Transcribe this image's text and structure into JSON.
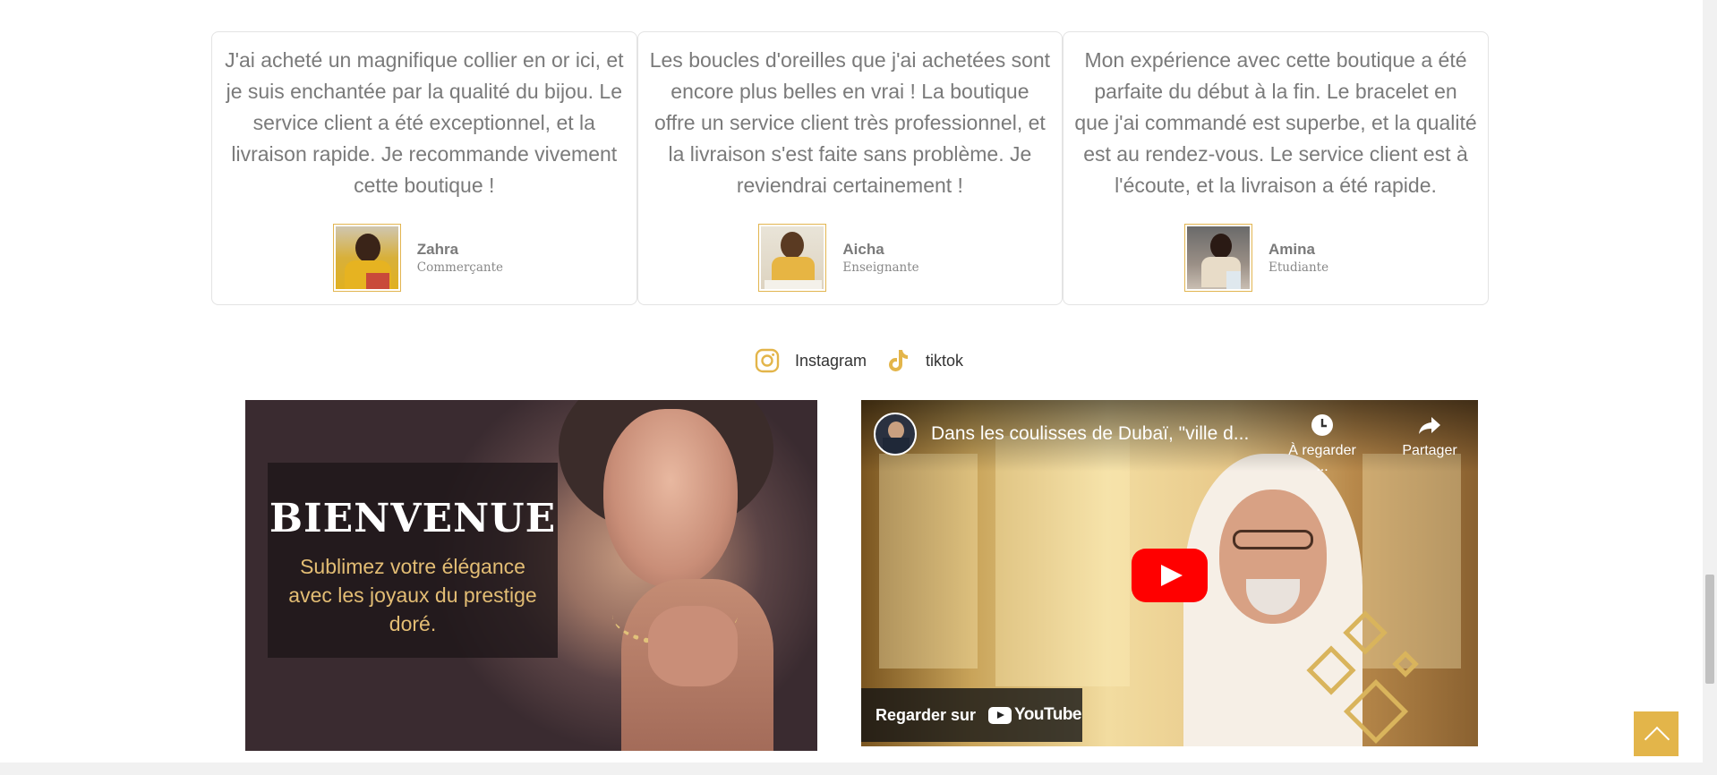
{
  "testimonials": [
    {
      "text": "J'ai acheté un magnifique collier en or ici, et je suis enchantée par la qualité du bijou. Le service client a été exceptionnel, et la livraison rapide. Je recommande vivement cette boutique !",
      "name": "Zahra",
      "role": "Commerçante"
    },
    {
      "text": "Les boucles d'oreilles que j'ai achetées sont encore plus belles en vrai ! La boutique offre un service client très professionnel, et la livraison s'est faite sans problème. Je reviendrai certainement !",
      "name": "Aicha",
      "role": "Enseignante"
    },
    {
      "text": "Mon expérience avec cette boutique a été parfaite du début à la fin. Le bracelet en que j'ai commandé est superbe, et la qualité est au rendez-vous. Le service client est à l'écoute, et la livraison a été rapide.",
      "name": "Amina",
      "role": "Etudiante"
    }
  ],
  "socials": {
    "instagram": "Instagram",
    "tiktok": "tiktok",
    "icon_color": "#e3b54a"
  },
  "banner": {
    "title": "BIENVENUE",
    "subtitle": "Sublimez votre élégance avec les joyaux du prestige doré."
  },
  "video": {
    "title": "Dans les coulisses de Dubaï, \"ville d...",
    "watch_later": "À regarder ...",
    "share": "Partager",
    "watch_on": "Regarder sur",
    "youtube": "YouTube"
  },
  "colors": {
    "accent": "#e3b54a",
    "text": "#7a7a7a",
    "youtube_red": "#ff0000"
  }
}
